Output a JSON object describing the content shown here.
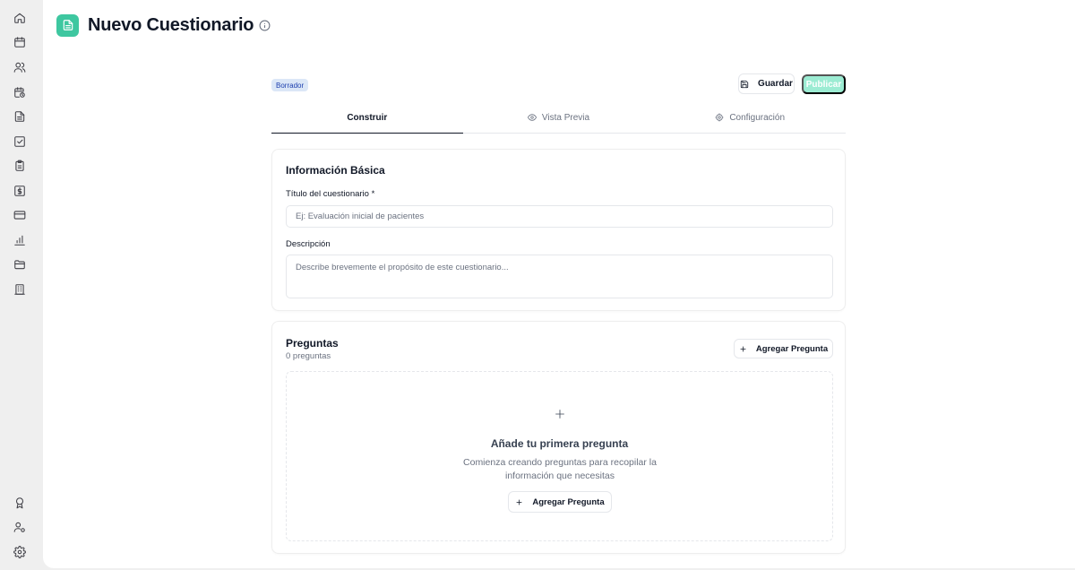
{
  "header": {
    "title": "Nuevo Cuestionario",
    "logo_icon": "document-icon",
    "accent_color": "#3ec7a0"
  },
  "sidebar": {
    "top_icons": [
      "home-icon",
      "calendar-icon",
      "users-icon",
      "calendar-clock-icon",
      "document-icon",
      "checkbox-icon",
      "clipboard-icon",
      "dollar-icon",
      "credit-card-icon",
      "bar-chart-icon",
      "folder-icon",
      "building-icon"
    ],
    "bottom_icons": [
      "award-icon",
      "user-settings-icon",
      "gear-icon"
    ]
  },
  "toolbar": {
    "status": "Borrador",
    "save_label": "Guardar",
    "publish_label": "Publicar"
  },
  "tabs": [
    {
      "label": "Construir",
      "active": true
    },
    {
      "label": "Vista Previa",
      "active": false,
      "icon": "eye-icon"
    },
    {
      "label": "Configuración",
      "active": false,
      "icon": "gear-icon"
    }
  ],
  "basic_info": {
    "title": "Información Básica",
    "title_label": "Título del cuestionario *",
    "title_placeholder": "Ej: Evaluación inicial de pacientes",
    "description_label": "Descripción",
    "description_placeholder": "Describe brevemente el propósito de este cuestionario..."
  },
  "questions": {
    "title": "Preguntas",
    "count": "0 preguntas",
    "add_label": "Agregar Pregunta",
    "empty_title": "Añade tu primera pregunta",
    "empty_description": "Comienza creando preguntas para recopilar la información que necesitas",
    "empty_add_label": "Agregar Pregunta"
  }
}
